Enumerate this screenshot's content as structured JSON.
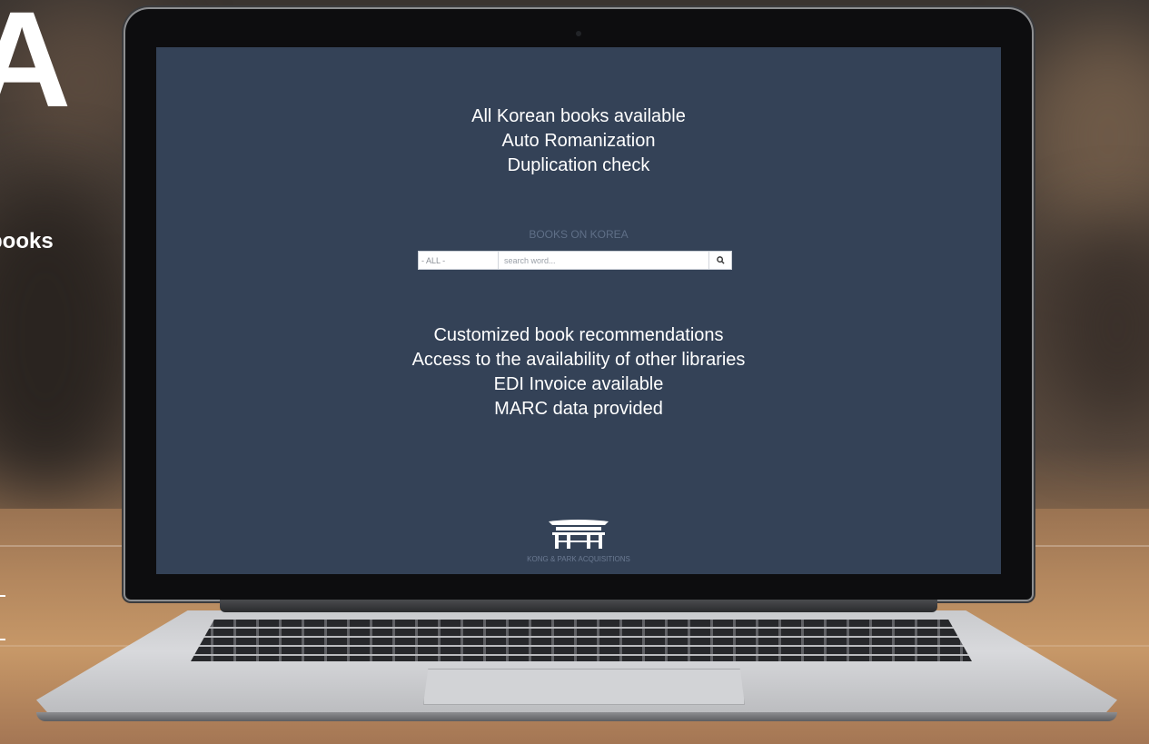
{
  "background": {
    "edge_letter": "A",
    "edge_word": "books"
  },
  "screen": {
    "features_top": [
      "All Korean books available",
      "Auto Romanization",
      "Duplication check"
    ],
    "search": {
      "title": "BOOKS ON KOREA",
      "select_value": "- ALL -",
      "placeholder": "search word...",
      "button_icon": "search-icon"
    },
    "features_bottom": [
      "Customized book recommendations",
      "Access to the availability of other libraries",
      "EDI Invoice available",
      "MARC data provided"
    ],
    "logo": {
      "icon": "gate-icon",
      "text": "KONG & PARK ACQUISITIONS"
    }
  },
  "colors": {
    "screen_bg": "#344257",
    "text": "#ffffff",
    "muted": "#5f6f87"
  }
}
